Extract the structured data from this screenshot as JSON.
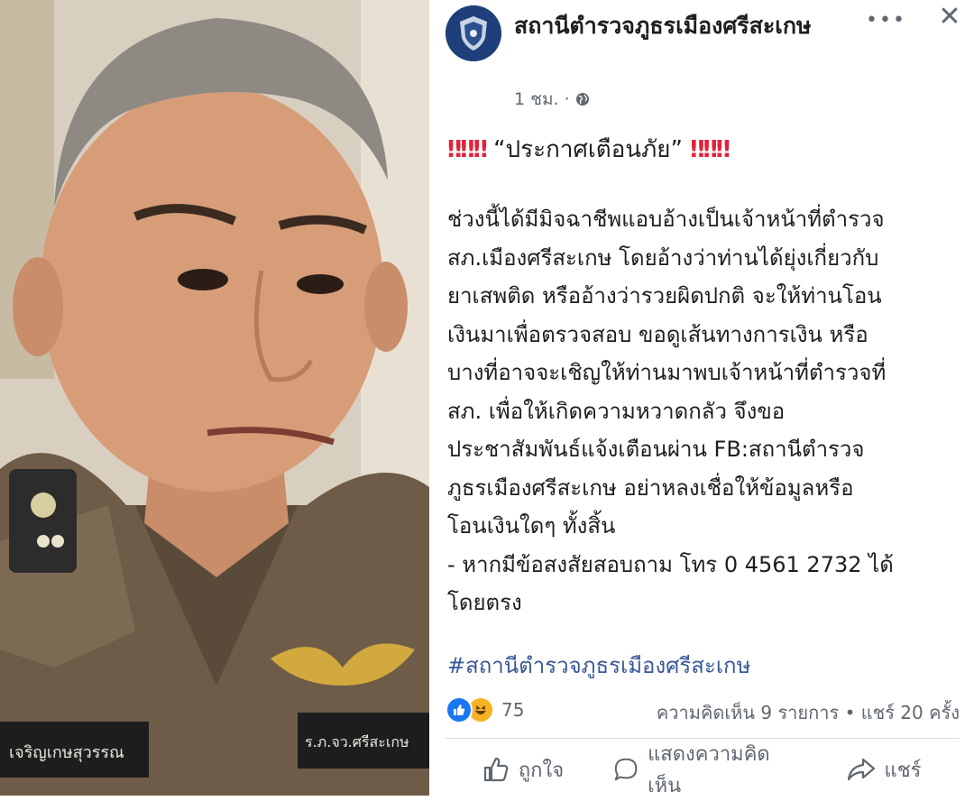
{
  "photo": {
    "badge_name": "เจริญเกษสุวรรณ",
    "shoulder_tag": "ร.ภ.จว.ศรีสะเกษ"
  },
  "post": {
    "page_name": "สถานีตำรวจภูธรเมืองศรีสะเกษ",
    "time": "1 ชม.",
    "separator": "·",
    "more_label": "•••",
    "close_label": "✕",
    "headline_marks_left": "‼‼‼",
    "headline_text": "“ประกาศเตือนภัย”",
    "headline_marks_right": "‼‼‼",
    "body_lines": [
      "ช่วงนี้ได้มีมิจฉาชีพแอบอ้างเป็นเจ้าหน้าที่ตำรวจ",
      "สภ.เมืองศรีสะเกษ โดยอ้างว่าท่านได้ยุ่งเกี่ยวกับ",
      "ยาเสพติด หรืออ้างว่ารวยผิดปกติ จะให้ท่านโอน",
      "เงินมาเพื่อตรวจสอบ ขอดูเส้นทางการเงิน หรือ",
      "บางที่อาจจะเชิญให้ท่านมาพบเจ้าหน้าที่ตำรวจที่",
      "สภ. เพื่อให้เกิดความหวาดกลัว  จึงขอ",
      "ประชาสัมพันธ์แจ้งเตือนผ่าน FB:สถานีตำรวจ",
      "ภูธรเมืองศรีสะเกษ  อย่าหลงเชื่อให้ข้อมูลหรือ",
      "โอนเงินใดๆ ทั้งสิ้น",
      "- หากมีข้อสงสัยสอบถาม โทร 0 4561 2732 ได้",
      "โดยตรง"
    ],
    "hashtag": "#สถานีตำรวจภูธรเมืองศรีสะเกษ",
    "reaction_count": "75",
    "stats": "ความคิดเห็น 9 รายการ • แชร์ 20 ครั้ง",
    "actions": {
      "like": "ถูกใจ",
      "comment": "แสดงความคิดเห็น",
      "share": "แชร์"
    }
  },
  "colors": {
    "link": "#385898",
    "muted": "#606770",
    "alert": "#e0243a",
    "like_blue": "#1877f2"
  }
}
